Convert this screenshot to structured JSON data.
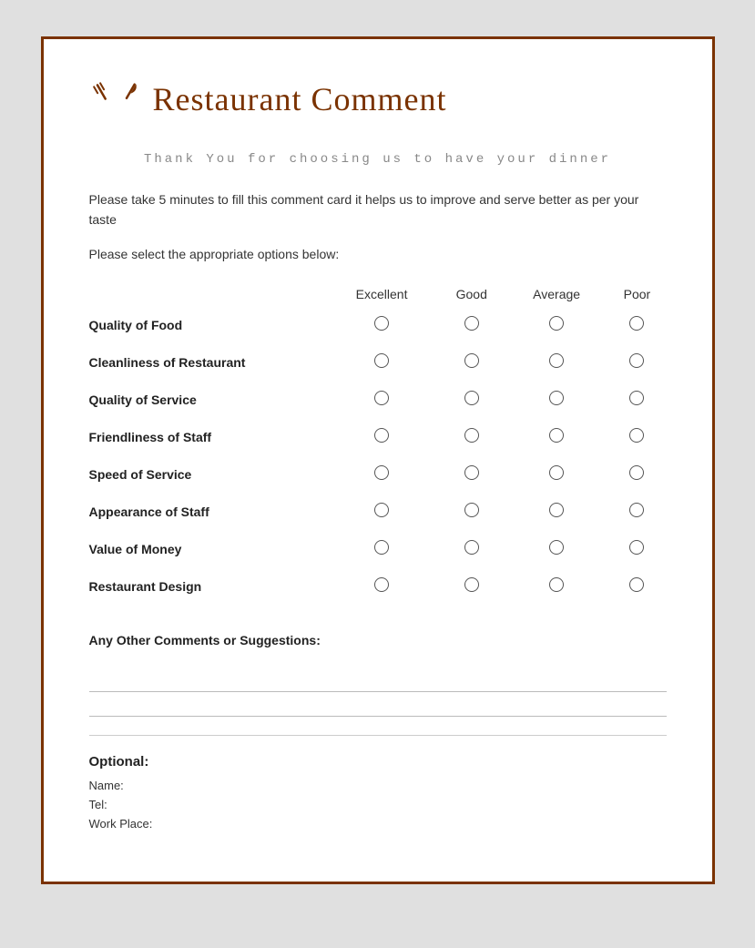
{
  "header": {
    "title": "Restaurant Comment"
  },
  "thank_you": "Thank You for choosing us to have your\ndinner",
  "description": "Please take 5 minutes to fill this comment card it helps us to improve and serve better as per your taste",
  "instruction": "Please select the appropriate options below:",
  "table": {
    "columns": [
      "",
      "Excellent",
      "Good",
      "Average",
      "Poor"
    ],
    "rows": [
      {
        "label": "Quality of Food"
      },
      {
        "label": "Cleanliness of Restaurant"
      },
      {
        "label": "Quality of Service"
      },
      {
        "label": "Friendliness of Staff"
      },
      {
        "label": "Speed of Service"
      },
      {
        "label": "Appearance of Staff"
      },
      {
        "label": "Value of Money"
      },
      {
        "label": "Restaurant Design"
      }
    ]
  },
  "comments": {
    "label": "Any Other Comments or Suggestions:"
  },
  "optional": {
    "title": "Optional:",
    "name_label": "Name:",
    "tel_label": "Tel:",
    "workplace_label": "Work Place:"
  }
}
